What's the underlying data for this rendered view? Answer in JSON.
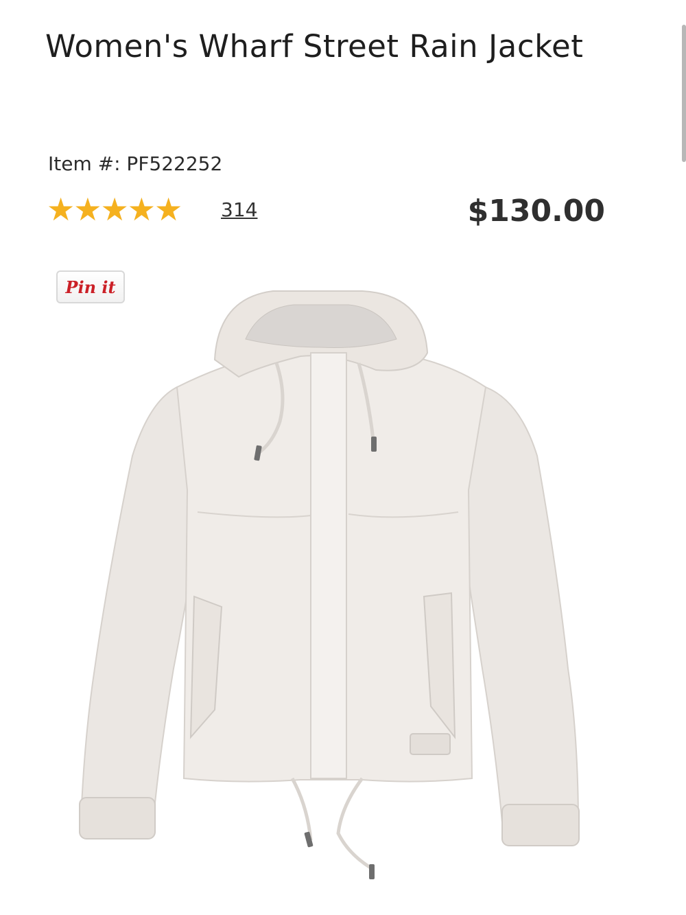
{
  "product": {
    "title": "Women's Wharf Street Rain Jacket",
    "item_number": "Item #: PF522252",
    "rating": 4.5,
    "rating_max": 5,
    "rating_stars_glyph": "★★★★★",
    "review_count": "314",
    "price": "$130.00"
  },
  "pin_button": {
    "label": "Pin it"
  },
  "colors": {
    "star": "#f5b11f",
    "pinterest": "#cb2027",
    "jacket": "#ece8e4"
  }
}
